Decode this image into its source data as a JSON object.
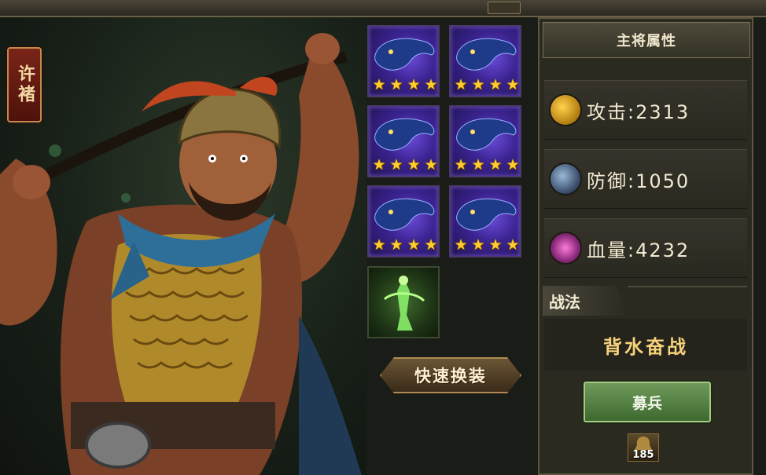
{
  "hero": {
    "name": "许褚"
  },
  "equipment": {
    "slots": [
      {
        "stars": 4
      },
      {
        "stars": 4
      },
      {
        "stars": 4
      },
      {
        "stars": 4
      },
      {
        "stars": 4
      },
      {
        "stars": 4
      }
    ],
    "star_glyph": "★",
    "quick_change_label": "快速换装"
  },
  "attributes": {
    "title": "主将属性",
    "attack": {
      "label": "攻击",
      "value": "2313",
      "icon": "attack-icon"
    },
    "defense": {
      "label": "防御",
      "value": "1050",
      "icon": "defense-icon"
    },
    "hp": {
      "label": "血量",
      "value": "4232",
      "icon": "hp-icon"
    },
    "separator": ":"
  },
  "tactic": {
    "header": "战法",
    "name": "背水奋战"
  },
  "recruit": {
    "label": "募兵",
    "troops": "185"
  },
  "colors": {
    "star": "#ffce2e",
    "tactic": "#f7d27a",
    "recruit": "#4e7e3e"
  }
}
